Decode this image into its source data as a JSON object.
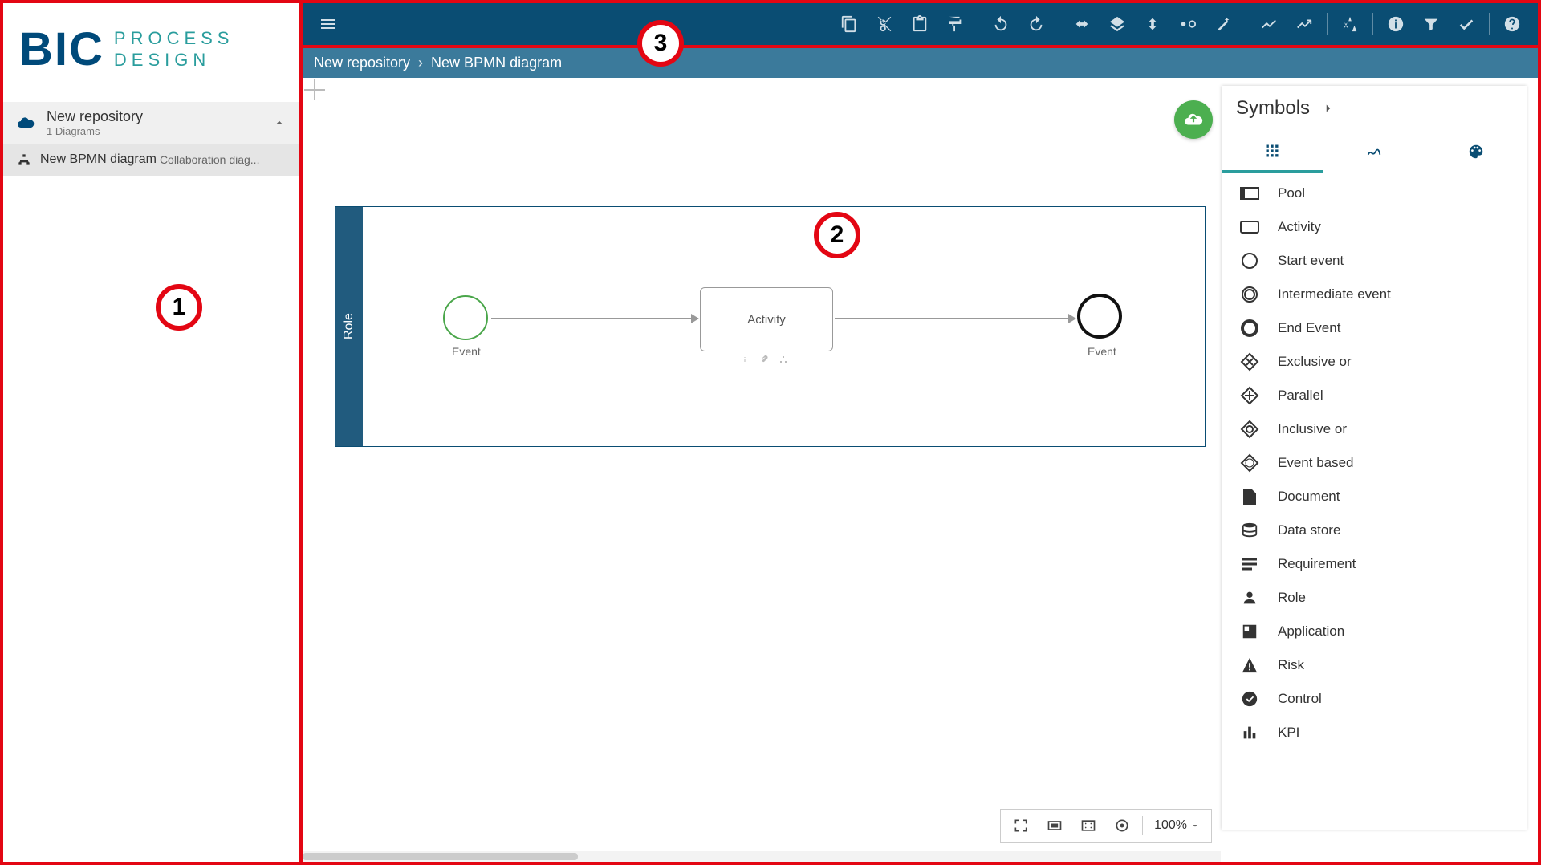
{
  "logo": {
    "bic": "BIC",
    "line1": "PROCESS",
    "line2": "DESIGN"
  },
  "sidebar": {
    "repo_name": "New repository",
    "repo_count": "1 Diagrams",
    "diagram_name": "New BPMN diagram",
    "diagram_type": "Collaboration diag..."
  },
  "breadcrumb": {
    "root": "New repository",
    "current": "New BPMN diagram"
  },
  "canvas": {
    "pool_label": "Role",
    "start_label": "Event",
    "activity_label": "Activity",
    "end_label": "Event"
  },
  "symbols": {
    "title": "Symbols",
    "items": [
      {
        "label": "Pool"
      },
      {
        "label": "Activity"
      },
      {
        "label": "Start event"
      },
      {
        "label": "Intermediate event"
      },
      {
        "label": "End Event"
      },
      {
        "label": "Exclusive or"
      },
      {
        "label": "Parallel"
      },
      {
        "label": "Inclusive or"
      },
      {
        "label": "Event based"
      },
      {
        "label": "Document"
      },
      {
        "label": "Data store"
      },
      {
        "label": "Requirement"
      },
      {
        "label": "Role"
      },
      {
        "label": "Application"
      },
      {
        "label": "Risk"
      },
      {
        "label": "Control"
      },
      {
        "label": "KPI"
      }
    ]
  },
  "zoom": {
    "level": "100%"
  },
  "annotations": {
    "a1": "1",
    "a2": "2",
    "a3": "3"
  }
}
